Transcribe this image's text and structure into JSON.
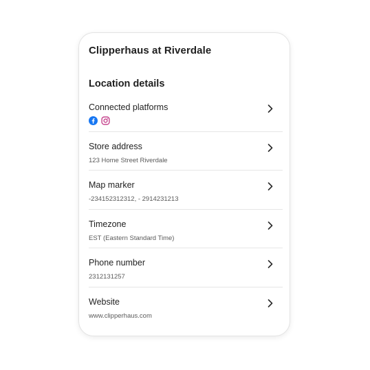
{
  "card": {
    "store_name": "Clipperhaus at Riverdale",
    "section_title": "Location details"
  },
  "rows": [
    {
      "label": "Connected platforms",
      "value": "",
      "icons": [
        "facebook-icon",
        "instagram-icon"
      ]
    },
    {
      "label": "Store address",
      "value": "123 Home Street Riverdale"
    },
    {
      "label": "Map marker",
      "value": "-234152312312, - 2914231213"
    },
    {
      "label": "Timezone",
      "value": "EST (Eastern Standard Time)"
    },
    {
      "label": "Phone number",
      "value": "2312131257"
    },
    {
      "label": "Website",
      "value": "www.clipperhaus.com"
    }
  ],
  "colors": {
    "facebook": "#1877F2",
    "instagram": "#C13584",
    "divider": "#e6e6e6",
    "chevron": "#2a2a2a"
  }
}
